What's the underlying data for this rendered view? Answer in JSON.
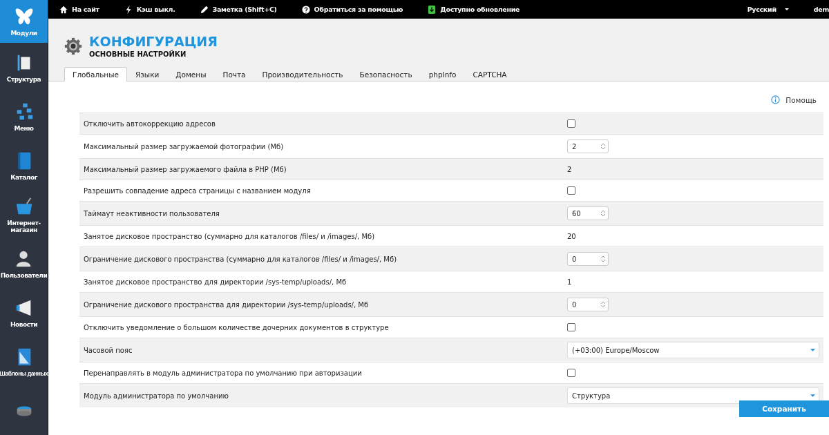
{
  "sidebar": {
    "items": [
      {
        "label": "Модули",
        "kind": "butterfly",
        "selected": true
      },
      {
        "label": "Структура",
        "kind": "structure",
        "selected": false
      },
      {
        "label": "Меню",
        "kind": "menu",
        "selected": false
      },
      {
        "label": "Каталог",
        "kind": "book",
        "selected": false
      },
      {
        "label": "Интернет-магазин",
        "kind": "basket",
        "selected": false
      },
      {
        "label": "Пользователи",
        "kind": "user",
        "selected": false
      },
      {
        "label": "Новости",
        "kind": "megaphone",
        "selected": false
      },
      {
        "label": "Шаблоны данных",
        "kind": "ruler",
        "selected": false
      },
      {
        "kind": "disk",
        "selected": false
      }
    ]
  },
  "topbar": {
    "items": [
      {
        "label": "На сайт",
        "kind": "home"
      },
      {
        "label": "Кэш выкл.",
        "kind": "bolt"
      },
      {
        "label": "Заметка (Shift+C)",
        "kind": "pen"
      },
      {
        "label": "Обратиться за помощью",
        "kind": "question"
      },
      {
        "label": "Доступно обновление",
        "kind": "update"
      }
    ],
    "language": "Русский",
    "user": "dem"
  },
  "header": {
    "title": "КОНФИГУРАЦИЯ",
    "subtitle": "ОСНОВНЫЕ НАСТРОЙКИ"
  },
  "tabs": [
    {
      "label": "Глобальные",
      "selected": true
    },
    {
      "label": "Языки",
      "selected": false
    },
    {
      "label": "Домены",
      "selected": false
    },
    {
      "label": "Почта",
      "selected": false
    },
    {
      "label": "Производительность",
      "selected": false
    },
    {
      "label": "Безопасность",
      "selected": false
    },
    {
      "label": "phpInfo",
      "selected": false
    },
    {
      "label": "CAPTCHA",
      "selected": false
    }
  ],
  "help": "Помощь",
  "settings": [
    {
      "label": "Отключить автокоррекцию адресов",
      "kind": "checkbox",
      "checked": false
    },
    {
      "label": "Максимальный размер загружаемой фотографии (Мб)",
      "kind": "number",
      "value": "2"
    },
    {
      "label": "Максимальный размер загружаемого файла в PHP (Мб)",
      "kind": "text",
      "value": "2"
    },
    {
      "label": "Разрешить совпадение адреса страницы с названием модуля",
      "kind": "checkbox",
      "checked": false
    },
    {
      "label": "Таймаут неактивности пользователя",
      "kind": "number",
      "value": "60"
    },
    {
      "label": "Занятое дисковое пространство (суммарно для каталогов /files/ и /images/, Мб)",
      "kind": "text",
      "value": "20"
    },
    {
      "label": "Ограничение дискового пространства (суммарно для каталогов /files/ и /images/, Мб)",
      "kind": "number",
      "value": "0"
    },
    {
      "label": "Занятое дисковое пространство для директории /sys-temp/uploads/, Мб",
      "kind": "text",
      "value": "1"
    },
    {
      "label": "Ограничение дискового пространства для директории /sys-temp/uploads/, Мб",
      "kind": "number",
      "value": "0"
    },
    {
      "label": "Отключить уведомление о большом количестве дочерних документов в структуре",
      "kind": "checkbox",
      "checked": false
    },
    {
      "label": "Часовой пояс",
      "kind": "select",
      "value": "(+03:00) Europe/Moscow"
    },
    {
      "label": "Перенаправлять в модуль администратора по умолчанию при авторизации",
      "kind": "checkbox",
      "checked": false
    },
    {
      "label": "Модуль администратора по умолчанию",
      "kind": "select",
      "value": "Структура"
    }
  ],
  "save_button": "Сохранить"
}
